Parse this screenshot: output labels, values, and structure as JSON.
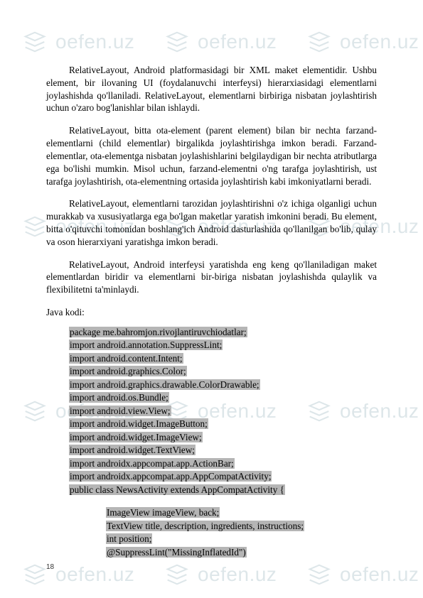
{
  "watermark": {
    "text": "oefen.uz",
    "icon": "stack-icon"
  },
  "paragraphs": {
    "p1": "RelativeLayout, Android platformasidagi bir XML maket elementidir. Ushbu element, bir ilovaning UI (foydalanuvchi interfeysi) hierarxiasidagi elementlarni joylashishda qo'llaniladi. RelativeLayout, elementlarni birbiriga nisbatan joylashtirish uchun o'zaro bog'lanishlar bilan ishlaydi.",
    "p2": "RelativeLayout, bitta ota-element (parent element) bilan bir nechta farzand-elementlarni (child elementlar) birgalikda joylashtirishga imkon beradi. Farzand-elementlar, ota-elementga nisbatan joylashishlarini belgilaydigan bir nechta atributlarga ega bo'lishi mumkin. Misol uchun, farzand-elementni o'ng tarafga joylashtirish, ust tarafga joylashtirish, ota-elementning ortasida joylashtirish kabi imkoniyatlarni beradi.",
    "p3": "RelativeLayout, elementlarni tarozidan joylashtirishni o'z ichiga olganligi uchun murakkab va xususiyatlarga ega bo'lgan maketlar yaratish imkonini beradi. Bu element, bitta o'qituvchi tomonidan boshlang'ich Android dasturlashida qo'llanilgan bo'lib, qulay va oson hierarxiyani yaratishga imkon beradi.",
    "p4": "RelativeLayout, Android interfeysi yaratishda eng keng qo'llaniladigan maket elementlardan biridir va elementlarni bir-biriga nisbatan joylashishda qulaylik va flexibilitetni ta'minlaydi.",
    "label": "Java kodi:"
  },
  "code": {
    "l1": "package me.bahromjon.rivojlantiruvchiodatlar;",
    "l2": "import android.annotation.SuppressLint;",
    "l3": "import android.content.Intent;",
    "l4": "import android.graphics.Color;",
    "l5": "import android.graphics.drawable.ColorDrawable;",
    "l6": "import android.os.Bundle;",
    "l7": "import android.view.View;",
    "l8": "import android.widget.ImageButton;",
    "l9": "import android.widget.ImageView;",
    "l10": "import android.widget.TextView;",
    "l11": "import androidx.appcompat.app.ActionBar;",
    "l12": "import androidx.appcompat.app.AppCompatActivity;",
    "l13": "public class NewsActivity extends AppCompatActivity {",
    "l14": "ImageView imageView, back;",
    "l15": "TextView title, description, ingredients, instructions;",
    "l16": "int position;",
    "l17": "@SuppressLint(\"MissingInflatedId\")"
  },
  "pageNumber": "18"
}
